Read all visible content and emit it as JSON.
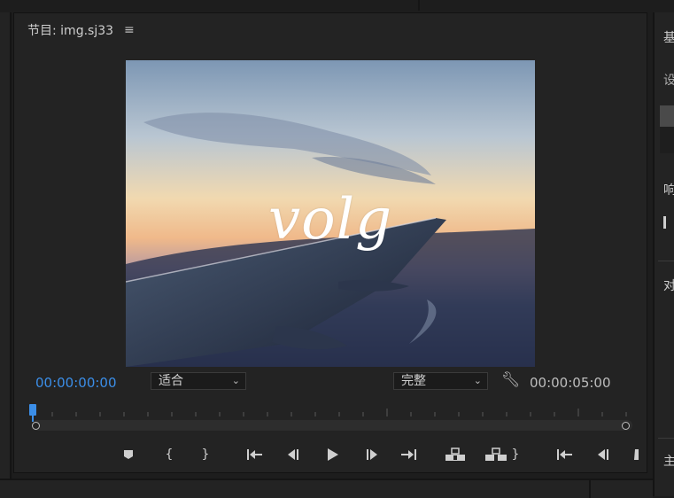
{
  "panel": {
    "title": "节目: img.sj33",
    "menu_icon": "hamburger-menu-icon"
  },
  "video": {
    "overlay_text": "volg"
  },
  "timecode": {
    "current": "00:00:00:00",
    "duration": "00:00:05:00"
  },
  "zoom_select": {
    "value": "适合"
  },
  "quality_select": {
    "value": "完整"
  },
  "playhead_position": 0,
  "controls": [
    "add-marker-icon",
    "mark-in-icon",
    "mark-out-icon",
    "go-to-in-icon",
    "step-back-icon",
    "play-icon",
    "step-forward-icon",
    "go-to-out-icon",
    "lift-icon",
    "extract-icon",
    "export-frame-icon",
    "step-back-icon"
  ],
  "right_panel": {
    "heading_1": "基",
    "heading_2": "设",
    "label_response": "响",
    "label_align": "对",
    "label_main": "主"
  },
  "colors": {
    "accent": "#3b8ee8",
    "panel_bg": "#232323",
    "app_bg": "#1d1d1d"
  }
}
